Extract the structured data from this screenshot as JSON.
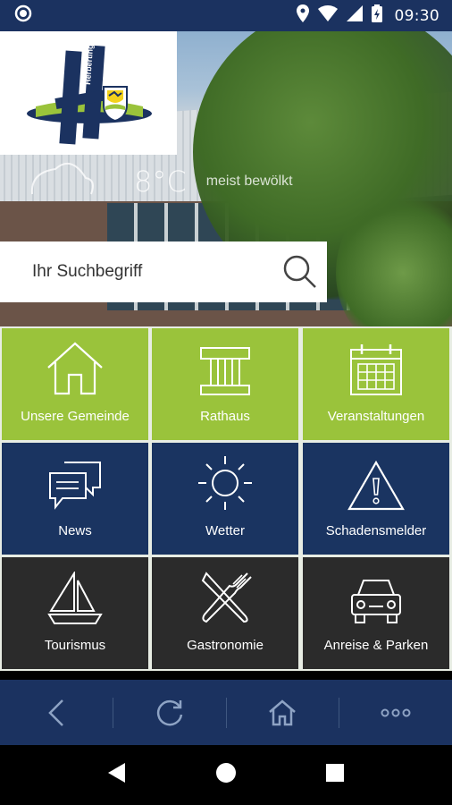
{
  "status_bar": {
    "time": "09:30"
  },
  "header": {
    "logo_text": "Herbertingen"
  },
  "weather": {
    "temperature": "8°C",
    "description": "meist bewölkt"
  },
  "search": {
    "placeholder": "Ihr Suchbegriff"
  },
  "tiles": [
    {
      "label": "Unsere Gemeinde",
      "icon": "home-icon"
    },
    {
      "label": "Rathaus",
      "icon": "town-hall-icon"
    },
    {
      "label": "Veranstaltungen",
      "icon": "calendar-icon"
    },
    {
      "label": "News",
      "icon": "chat-bubbles-icon"
    },
    {
      "label": "Wetter",
      "icon": "sun-icon"
    },
    {
      "label": "Schadensmelder",
      "icon": "warning-icon"
    },
    {
      "label": "Tourismus",
      "icon": "sailboat-icon"
    },
    {
      "label": "Gastronomie",
      "icon": "fork-knife-icon"
    },
    {
      "label": "Anreise & Parken",
      "icon": "car-icon"
    }
  ],
  "colors": {
    "navy": "#1a3461",
    "green": "#9ac33b",
    "dark": "#2b2b2b"
  },
  "app_nav": [
    "back-icon",
    "reload-icon",
    "home-icon",
    "more-icon"
  ]
}
